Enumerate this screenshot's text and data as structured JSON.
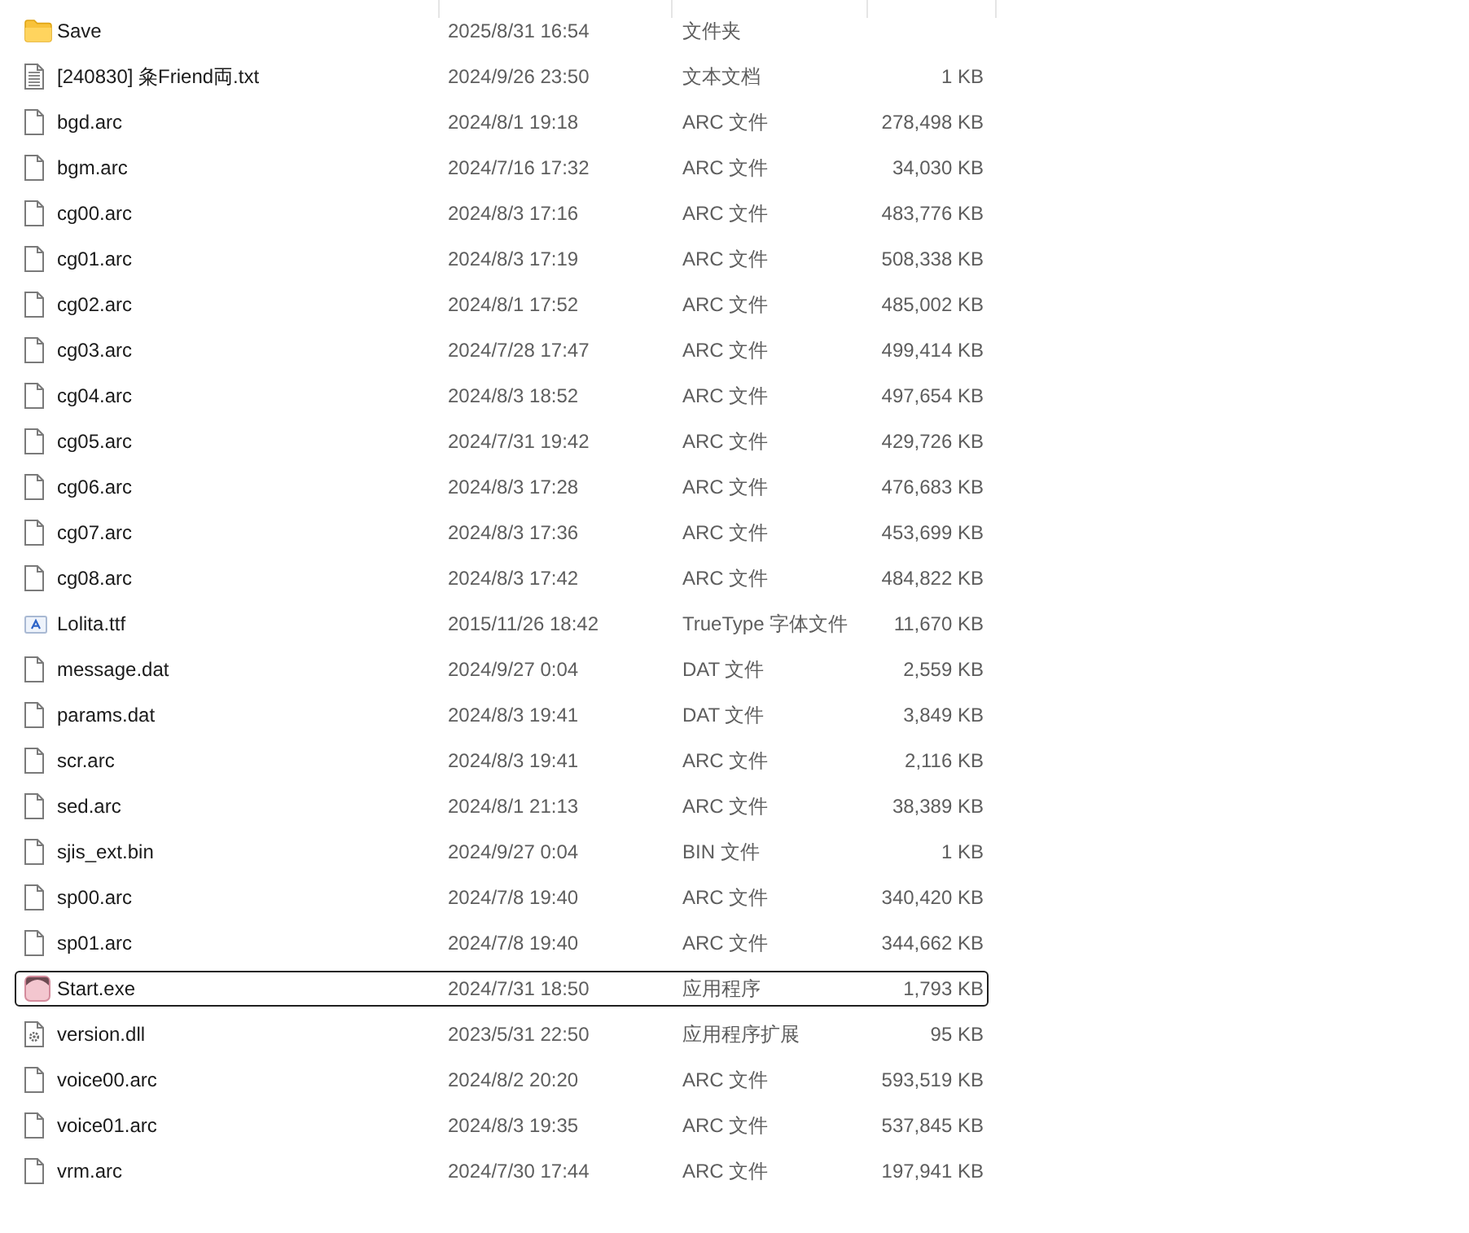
{
  "file_list": {
    "rows": [
      {
        "kind": "folder",
        "name": "Save",
        "modified": "2025/8/31 16:54",
        "type": "文件夹",
        "selected": false,
        "focused": false
      },
      {
        "kind": "text",
        "name": "[240830] 粂Friend両.txt",
        "modified": "2024/9/26 23:50",
        "type": "文本文档",
        "size": "1 KB",
        "selected": false,
        "focused": false
      },
      {
        "kind": "file",
        "name": "bgd.arc",
        "modified": "2024/8/1 19:18",
        "type": "ARC 文件",
        "size": "278,498 KB",
        "selected": false,
        "focused": false
      },
      {
        "kind": "file",
        "name": "bgm.arc",
        "modified": "2024/7/16 17:32",
        "type": "ARC 文件",
        "size": "34,030 KB",
        "selected": false,
        "focused": false
      },
      {
        "kind": "file",
        "name": "cg00.arc",
        "modified": "2024/8/3 17:16",
        "type": "ARC 文件",
        "size": "483,776 KB",
        "selected": false,
        "focused": false
      },
      {
        "kind": "file",
        "name": "cg01.arc",
        "modified": "2024/8/3 17:19",
        "type": "ARC 文件",
        "size": "508,338 KB",
        "selected": false,
        "focused": false
      },
      {
        "kind": "file",
        "name": "cg02.arc",
        "modified": "2024/8/1 17:52",
        "type": "ARC 文件",
        "size": "485,002 KB",
        "selected": false,
        "focused": false
      },
      {
        "kind": "file",
        "name": "cg03.arc",
        "modified": "2024/7/28 17:47",
        "type": "ARC 文件",
        "size": "499,414 KB",
        "selected": false,
        "focused": false
      },
      {
        "kind": "file",
        "name": "cg04.arc",
        "modified": "2024/8/3 18:52",
        "type": "ARC 文件",
        "size": "497,654 KB",
        "selected": false,
        "focused": false
      },
      {
        "kind": "file",
        "name": "cg05.arc",
        "modified": "2024/7/31 19:42",
        "type": "ARC 文件",
        "size": "429,726 KB",
        "selected": false,
        "focused": false
      },
      {
        "kind": "file",
        "name": "cg06.arc",
        "modified": "2024/8/3 17:28",
        "type": "ARC 文件",
        "size": "476,683 KB",
        "selected": false,
        "focused": false
      },
      {
        "kind": "file",
        "name": "cg07.arc",
        "modified": "2024/8/3 17:36",
        "type": "ARC 文件",
        "size": "453,699 KB",
        "selected": false,
        "focused": false
      },
      {
        "kind": "file",
        "name": "cg08.arc",
        "modified": "2024/8/3 17:42",
        "type": "ARC 文件",
        "size": "484,822 KB",
        "selected": false,
        "focused": false
      },
      {
        "kind": "font",
        "name": "Lolita.ttf",
        "modified": "2015/11/26 18:42",
        "type": "TrueType 字体文件",
        "size": "11,670 KB",
        "selected": false,
        "focused": false
      },
      {
        "kind": "file",
        "name": "message.dat",
        "modified": "2024/9/27 0:04",
        "type": "DAT 文件",
        "size": "2,559 KB",
        "selected": false,
        "focused": false
      },
      {
        "kind": "file",
        "name": "params.dat",
        "modified": "2024/8/3 19:41",
        "type": "DAT 文件",
        "size": "3,849 KB",
        "selected": false,
        "focused": false
      },
      {
        "kind": "file",
        "name": "scr.arc",
        "modified": "2024/8/3 19:41",
        "type": "ARC 文件",
        "size": "2,116 KB",
        "selected": false,
        "focused": false
      },
      {
        "kind": "file",
        "name": "sed.arc",
        "modified": "2024/8/1 21:13",
        "type": "ARC 文件",
        "size": "38,389 KB",
        "selected": false,
        "focused": false
      },
      {
        "kind": "file",
        "name": "sjis_ext.bin",
        "modified": "2024/9/27 0:04",
        "type": "BIN 文件",
        "size": "1 KB",
        "selected": false,
        "focused": false
      },
      {
        "kind": "file",
        "name": "sp00.arc",
        "modified": "2024/7/8 19:40",
        "type": "ARC 文件",
        "size": "340,420 KB",
        "selected": false,
        "focused": false
      },
      {
        "kind": "file",
        "name": "sp01.arc",
        "modified": "2024/7/8 19:40",
        "type": "ARC 文件",
        "size": "344,662 KB",
        "selected": false,
        "focused": false
      },
      {
        "kind": "app",
        "name": "Start.exe",
        "modified": "2024/7/31 18:50",
        "type": "应用程序",
        "size": "1,793 KB",
        "selected": false,
        "focused": true
      },
      {
        "kind": "dll",
        "name": "version.dll",
        "modified": "2023/5/31 22:50",
        "type": "应用程序扩展",
        "size": "95 KB",
        "selected": false,
        "focused": false
      },
      {
        "kind": "file",
        "name": "voice00.arc",
        "modified": "2024/8/2 20:20",
        "type": "ARC 文件",
        "size": "593,519 KB",
        "selected": false,
        "focused": false
      },
      {
        "kind": "file",
        "name": "voice01.arc",
        "modified": "2024/8/3 19:35",
        "type": "ARC 文件",
        "size": "537,845 KB",
        "selected": false,
        "focused": false
      },
      {
        "kind": "file",
        "name": "vrm.arc",
        "modified": "2024/7/30 17:44",
        "type": "ARC 文件",
        "size": "197,941 KB",
        "selected": false,
        "focused": false
      }
    ]
  }
}
